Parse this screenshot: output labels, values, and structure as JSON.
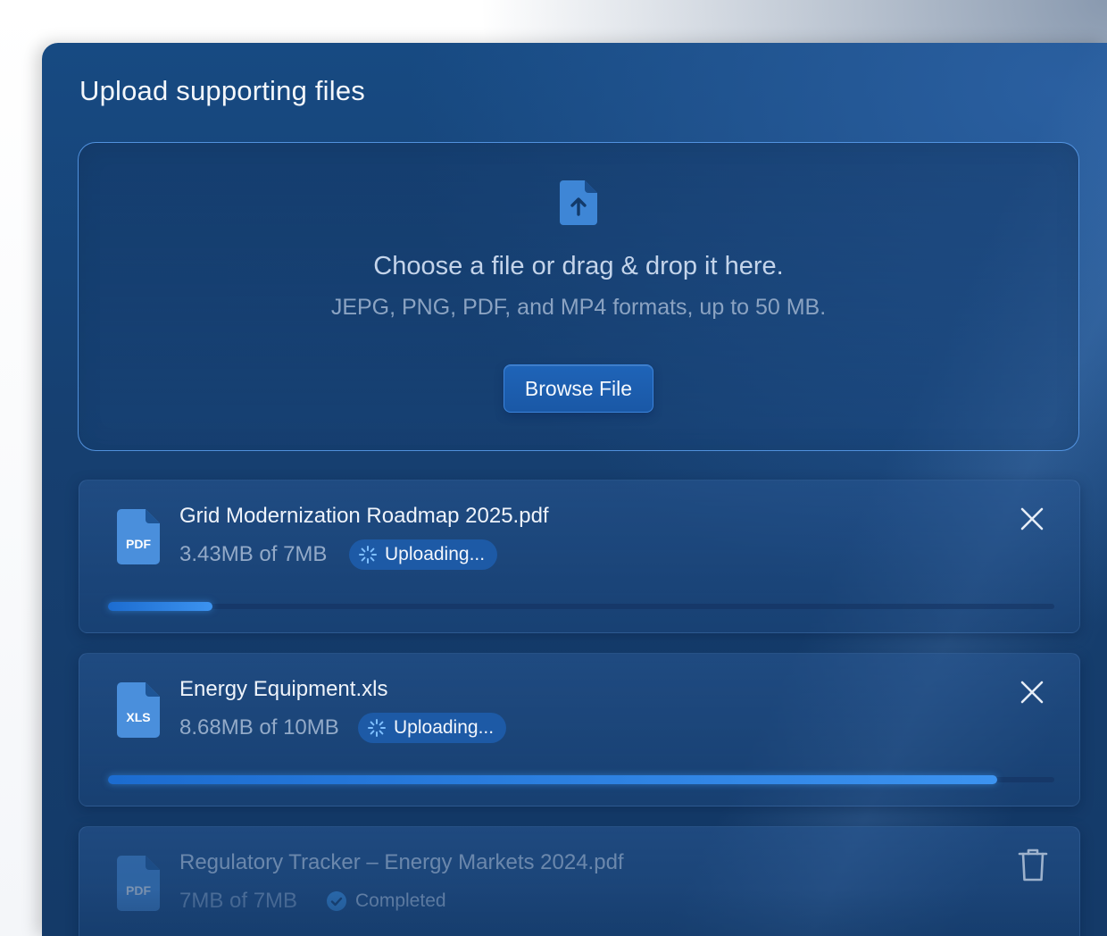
{
  "panel": {
    "title": "Upload supporting files"
  },
  "dropzone": {
    "icon": "file-upload-icon",
    "headline": "Choose a file or drag & drop it here.",
    "subtext": "JEPG, PNG, PDF, and MP4 formats, up to 50 MB.",
    "browse_label": "Browse File"
  },
  "files": [
    {
      "name": "Grid Modernization Roadmap 2025.pdf",
      "type_label": "PDF",
      "size_text": "3.43MB of 7MB",
      "status": "Uploading...",
      "progress": 0.11,
      "action_icon": "close-icon"
    },
    {
      "name": "Energy Equipment.xls",
      "type_label": "XLS",
      "size_text": "8.68MB of 10MB",
      "status": "Uploading...",
      "progress": 0.94,
      "action_icon": "close-icon"
    },
    {
      "name": "Regulatory Tracker – Energy Markets 2024.pdf",
      "type_label": "PDF",
      "size_text": "7MB of 7MB",
      "status": "Completed",
      "action_icon": "trash-icon"
    }
  ],
  "colors": {
    "panel_bg": "#163f70",
    "accent": "#3c93f0",
    "pill_bg": "#1d5aa6",
    "dropzone_border": "#5ca0f0"
  }
}
